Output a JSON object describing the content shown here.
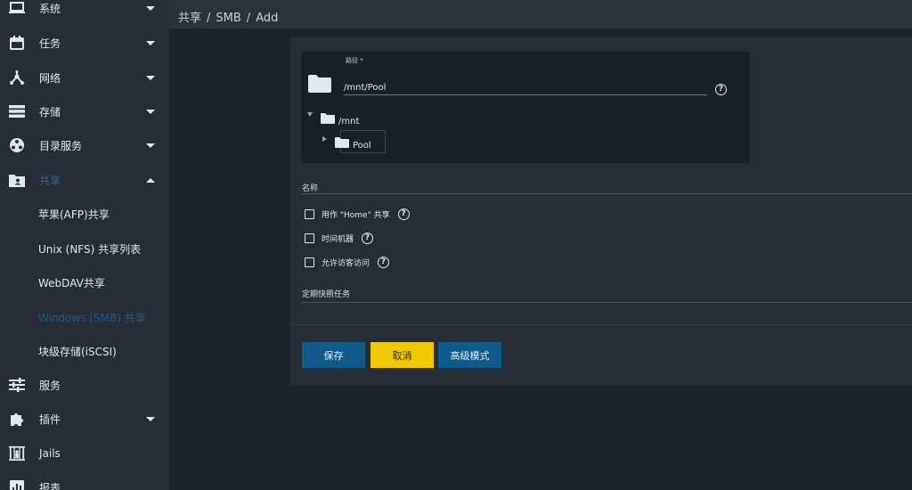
{
  "sidebar": {
    "items": [
      {
        "label": "系统",
        "icon": "laptop-icon",
        "caret": "down"
      },
      {
        "label": "任务",
        "icon": "calendar-icon",
        "caret": "down"
      },
      {
        "label": "网络",
        "icon": "network-icon",
        "caret": "down"
      },
      {
        "label": "存储",
        "icon": "storage-icon",
        "caret": "down"
      },
      {
        "label": "目录服务",
        "icon": "directory-icon",
        "caret": "down"
      },
      {
        "label": "共享",
        "icon": "share-folder-icon",
        "caret": "up",
        "active": true
      },
      {
        "label": "服务",
        "icon": "sliders-icon",
        "caret": "none"
      },
      {
        "label": "插件",
        "icon": "puzzle-icon",
        "caret": "down"
      },
      {
        "label": "Jails",
        "icon": "jail-icon",
        "caret": "none"
      },
      {
        "label": "报表",
        "icon": "chart-icon",
        "caret": "none"
      }
    ],
    "share_subitems": [
      {
        "label": "苹果(AFP)共享"
      },
      {
        "label": "Unix (NFS) 共享列表"
      },
      {
        "label": "WebDAV共享"
      },
      {
        "label": "Windows (SMB) 共享",
        "selected": true
      },
      {
        "label": "块级存储(iSCSI)"
      }
    ]
  },
  "breadcrumb": [
    "共享",
    "SMB",
    "Add"
  ],
  "breadcrumb_sep": "/",
  "form": {
    "path_label": "路径 *",
    "path_value": "/mnt/Pool",
    "help_glyph": "?",
    "tree": {
      "root": "/mnt",
      "child": "Pool"
    },
    "name_label": "名称",
    "checkboxes": [
      {
        "label": "用作 \"Home\" 共享",
        "checked": false
      },
      {
        "label": "时间机器",
        "checked": false
      },
      {
        "label": "允许访客访问",
        "checked": false
      }
    ],
    "snapshot_label": "定期快照任务"
  },
  "buttons": {
    "save": "保存",
    "cancel": "取消",
    "advanced": "高级模式"
  },
  "colors": {
    "primary": "#0e5a8a",
    "warning": "#f0c800",
    "active_text": "#2a6ea8"
  }
}
